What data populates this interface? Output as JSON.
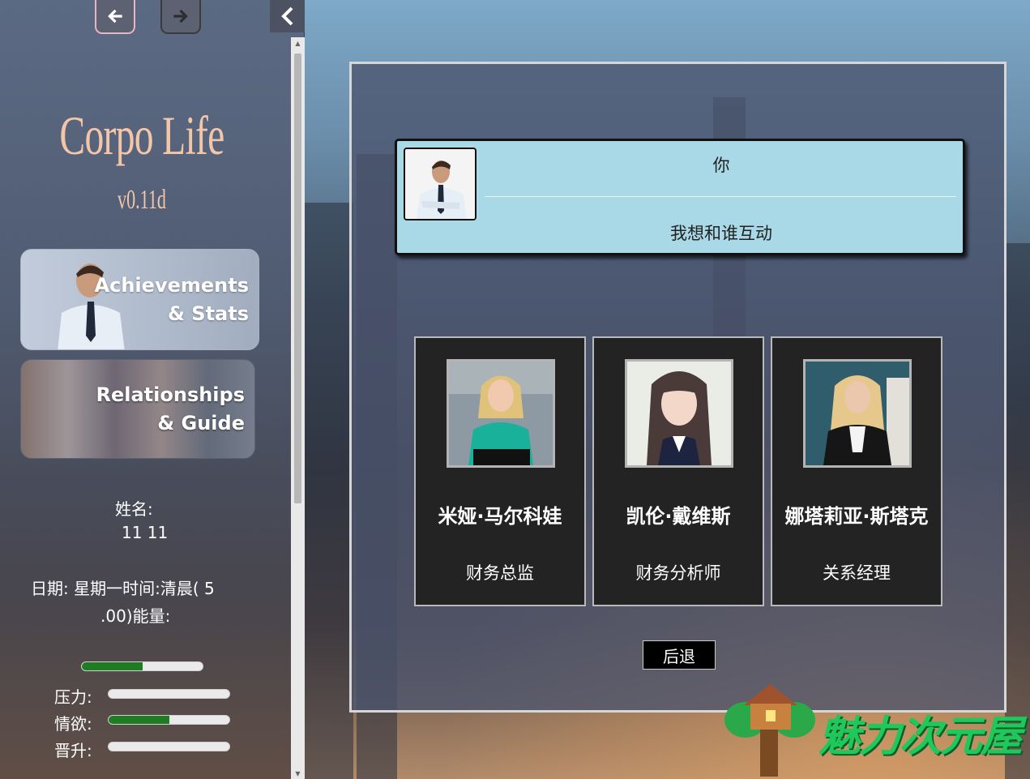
{
  "sidebar": {
    "back_icon": "arrow-left-icon",
    "forward_icon": "arrow-right-icon",
    "collapse_icon": "chevron-left-icon",
    "game_title": "Corpo Life",
    "version": "v0.11d",
    "achievements_label_1": "Achievements",
    "achievements_label_2": "& Stats",
    "relationships_label_1": "Relationships",
    "relationships_label_2": "& Guide",
    "name_label": "姓名:",
    "name_value": "11 11",
    "status_line1": "日期:  星期一时间:清晨( 5",
    "status_line2": ".00)能量:",
    "stats": [
      {
        "label": "",
        "value": 0.5
      },
      {
        "label": "压力:",
        "value": 0.0
      },
      {
        "label": "情欲:",
        "value": 0.5
      },
      {
        "label": "晋升:",
        "value": 0.0
      }
    ],
    "accent_color": "#1e7d22"
  },
  "dialog": {
    "speaker_name": "你",
    "speaker_line": "我想和谁互动",
    "characters": [
      {
        "name": "米娅·马尔科娃",
        "role": "财务总监"
      },
      {
        "name": "凯伦·戴维斯",
        "role": "财务分析师"
      },
      {
        "name": "娜塔莉亚·斯塔克",
        "role": "关系经理"
      }
    ],
    "back_button": "后退"
  },
  "watermark": {
    "text": "魅力次元屋"
  }
}
